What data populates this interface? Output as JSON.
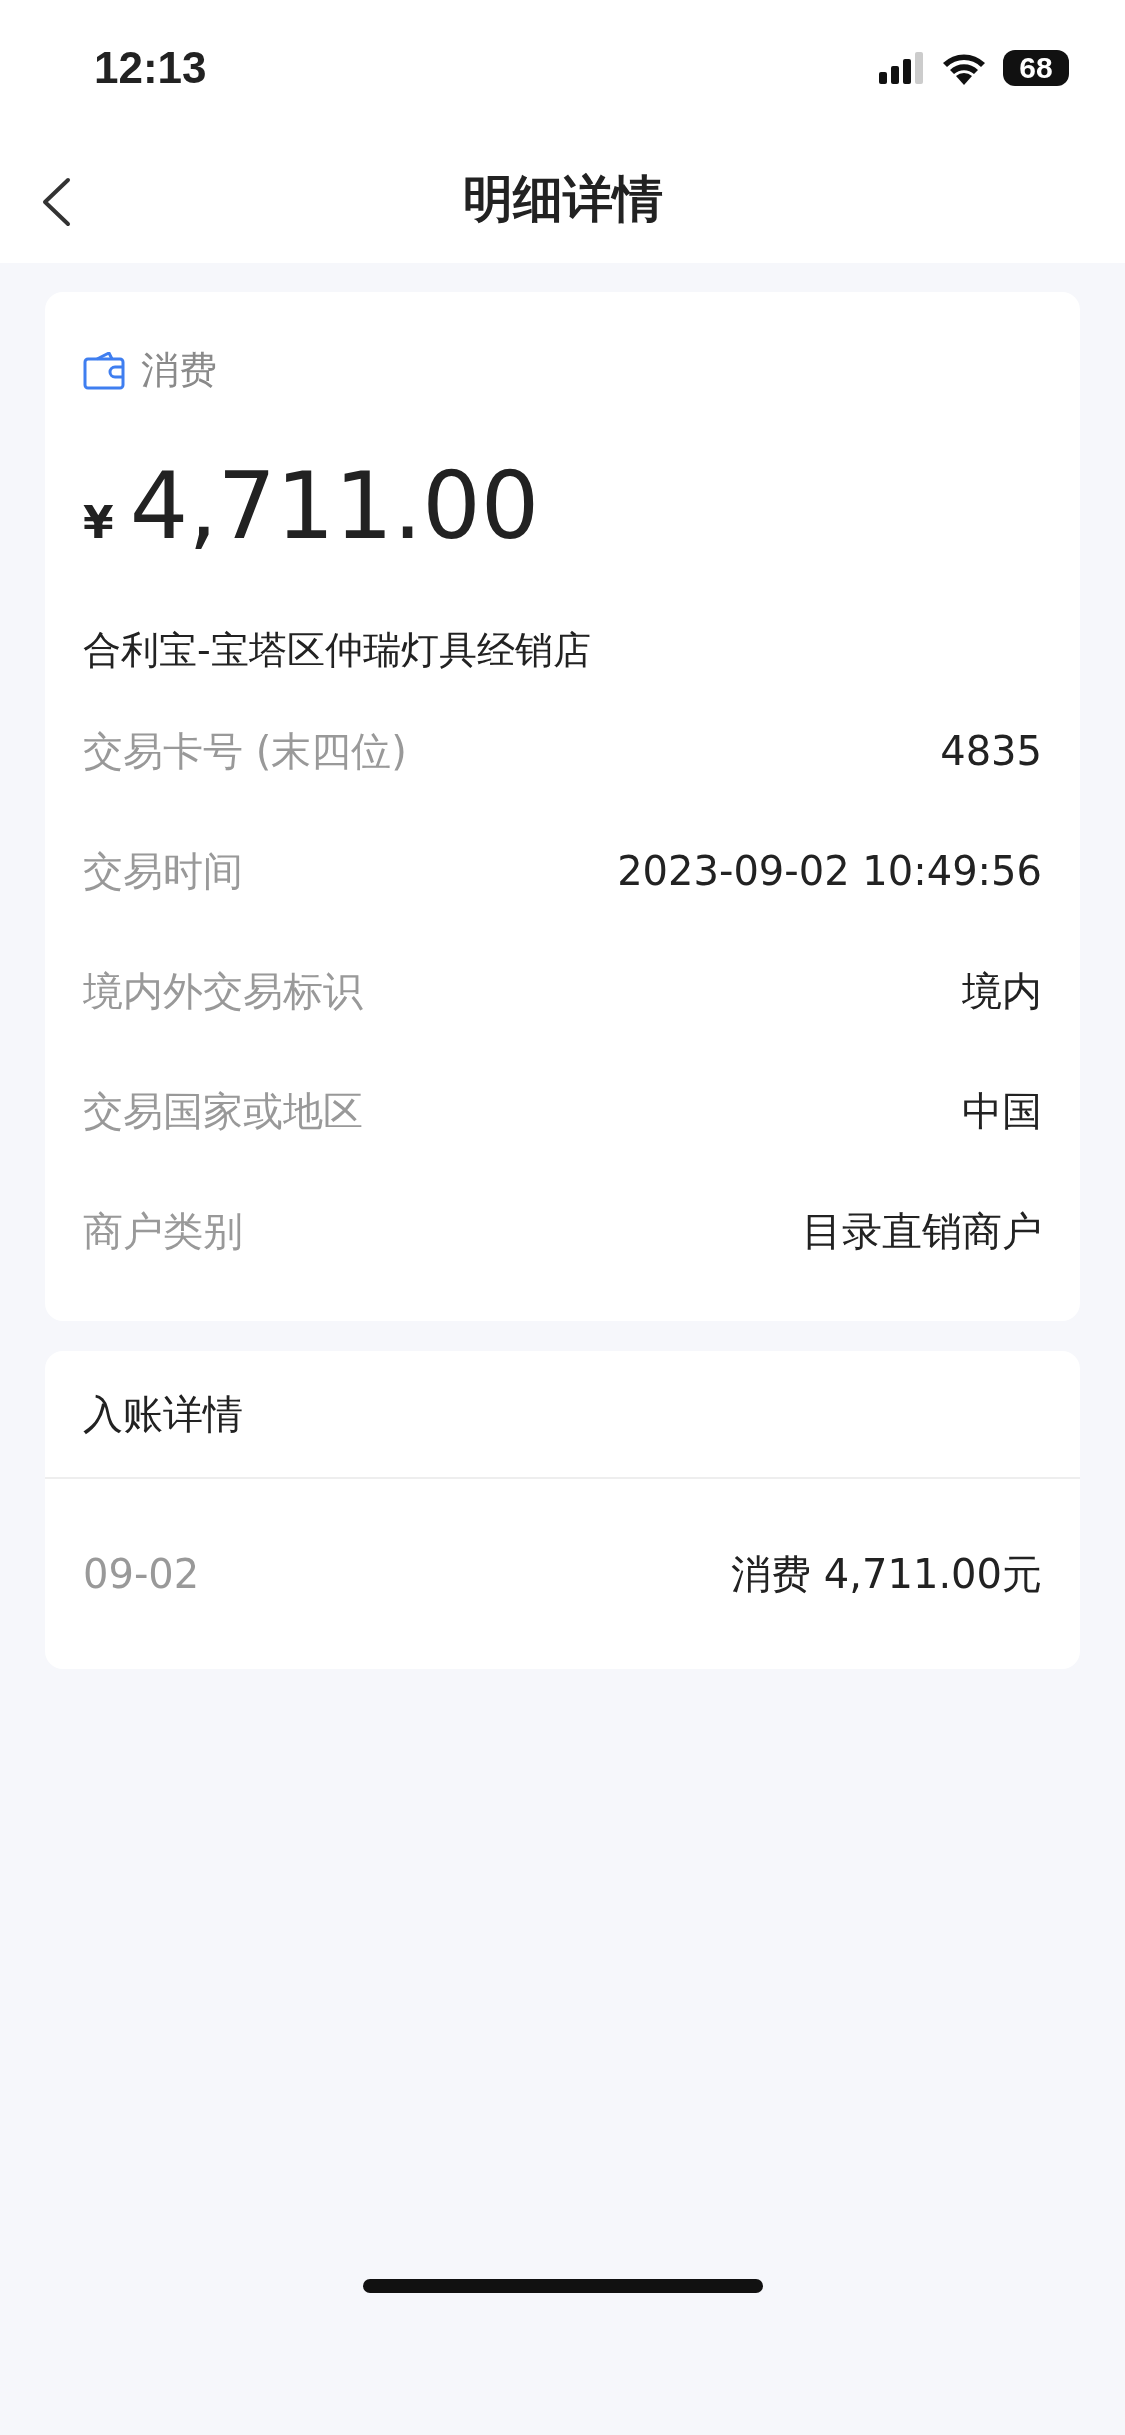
{
  "status_bar": {
    "time": "12:13",
    "battery": "68"
  },
  "nav": {
    "title": "明细详情"
  },
  "transaction": {
    "type_label": "消费",
    "currency": "¥",
    "amount": "4,711.00",
    "merchant": "合利宝-宝塔区仲瑞灯具经销店",
    "details": [
      {
        "label": "交易卡号 (末四位)",
        "value": "4835"
      },
      {
        "label": "交易时间",
        "value": "2023-09-02 10:49:56"
      },
      {
        "label": "境内外交易标识",
        "value": "境内"
      },
      {
        "label": "交易国家或地区",
        "value": "中国"
      },
      {
        "label": "商户类别",
        "value": "目录直销商户"
      }
    ]
  },
  "posting": {
    "title": "入账详情",
    "entries": [
      {
        "date": "09-02",
        "description": "消费 4,711.00元"
      }
    ]
  }
}
